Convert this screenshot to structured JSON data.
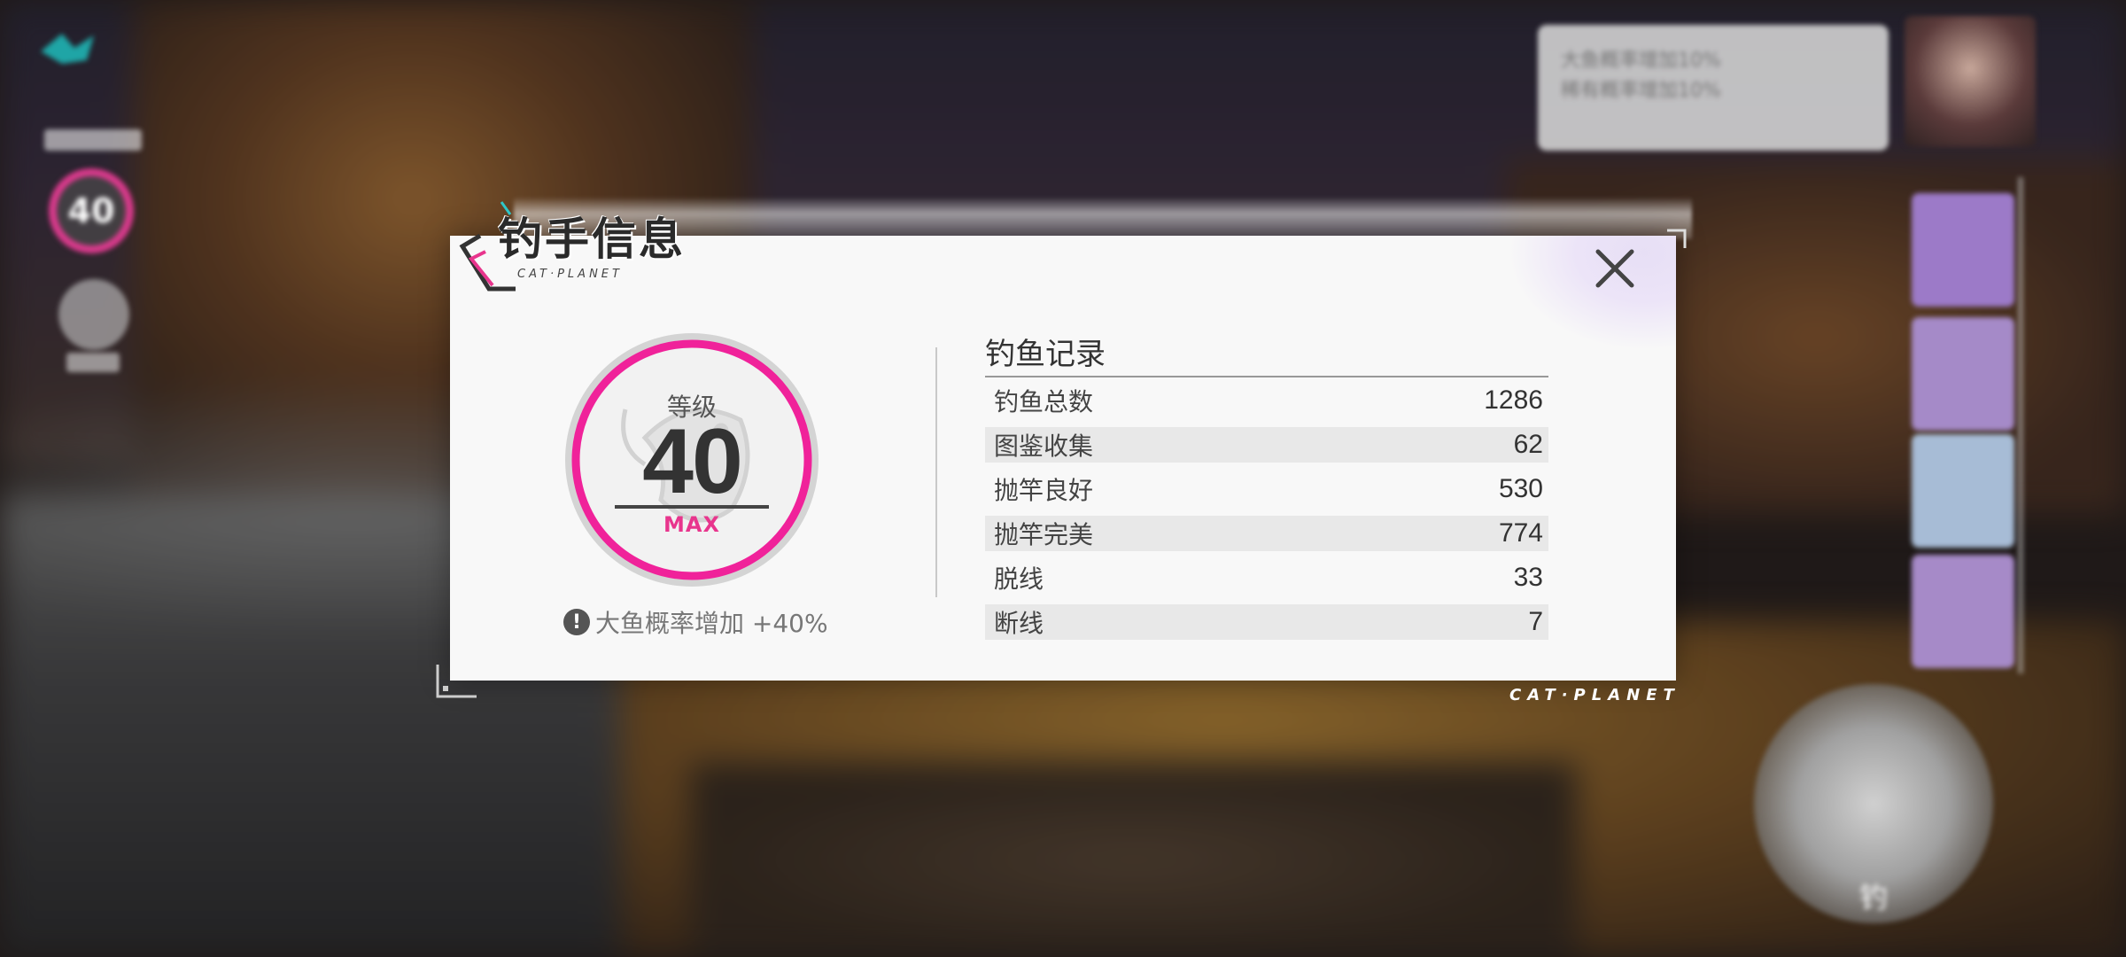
{
  "hud": {
    "level": "40",
    "buff_lines": [
      "大鱼概率增加10%",
      "稀有概率增加10%"
    ],
    "cast_label": "钓"
  },
  "dialog": {
    "title": "钓手信息",
    "title_sub": "CAT·PLANET",
    "brand_footer": "CAT·PLANET",
    "level_label": "等级",
    "level": "40",
    "level_max": "MAX",
    "bonus_text": "大鱼概率增加 +40%",
    "records_title": "钓鱼记录",
    "records": [
      {
        "label": "钓鱼总数",
        "value": "1286"
      },
      {
        "label": "图鉴收集",
        "value": "62"
      },
      {
        "label": "抛竿良好",
        "value": "530"
      },
      {
        "label": "抛竿完美",
        "value": "774"
      },
      {
        "label": "脱线",
        "value": "33"
      },
      {
        "label": "断线",
        "value": "7"
      }
    ]
  },
  "colors": {
    "accent_pink": "#e8358d",
    "ring_gray": "#d4d4d4",
    "dialog_bg": "#f8f8f8",
    "shade_row": "#e8e8e8"
  },
  "icons": {
    "close": "close-icon",
    "bonus": "info-icon",
    "fish_emblem": "fish-icon"
  }
}
